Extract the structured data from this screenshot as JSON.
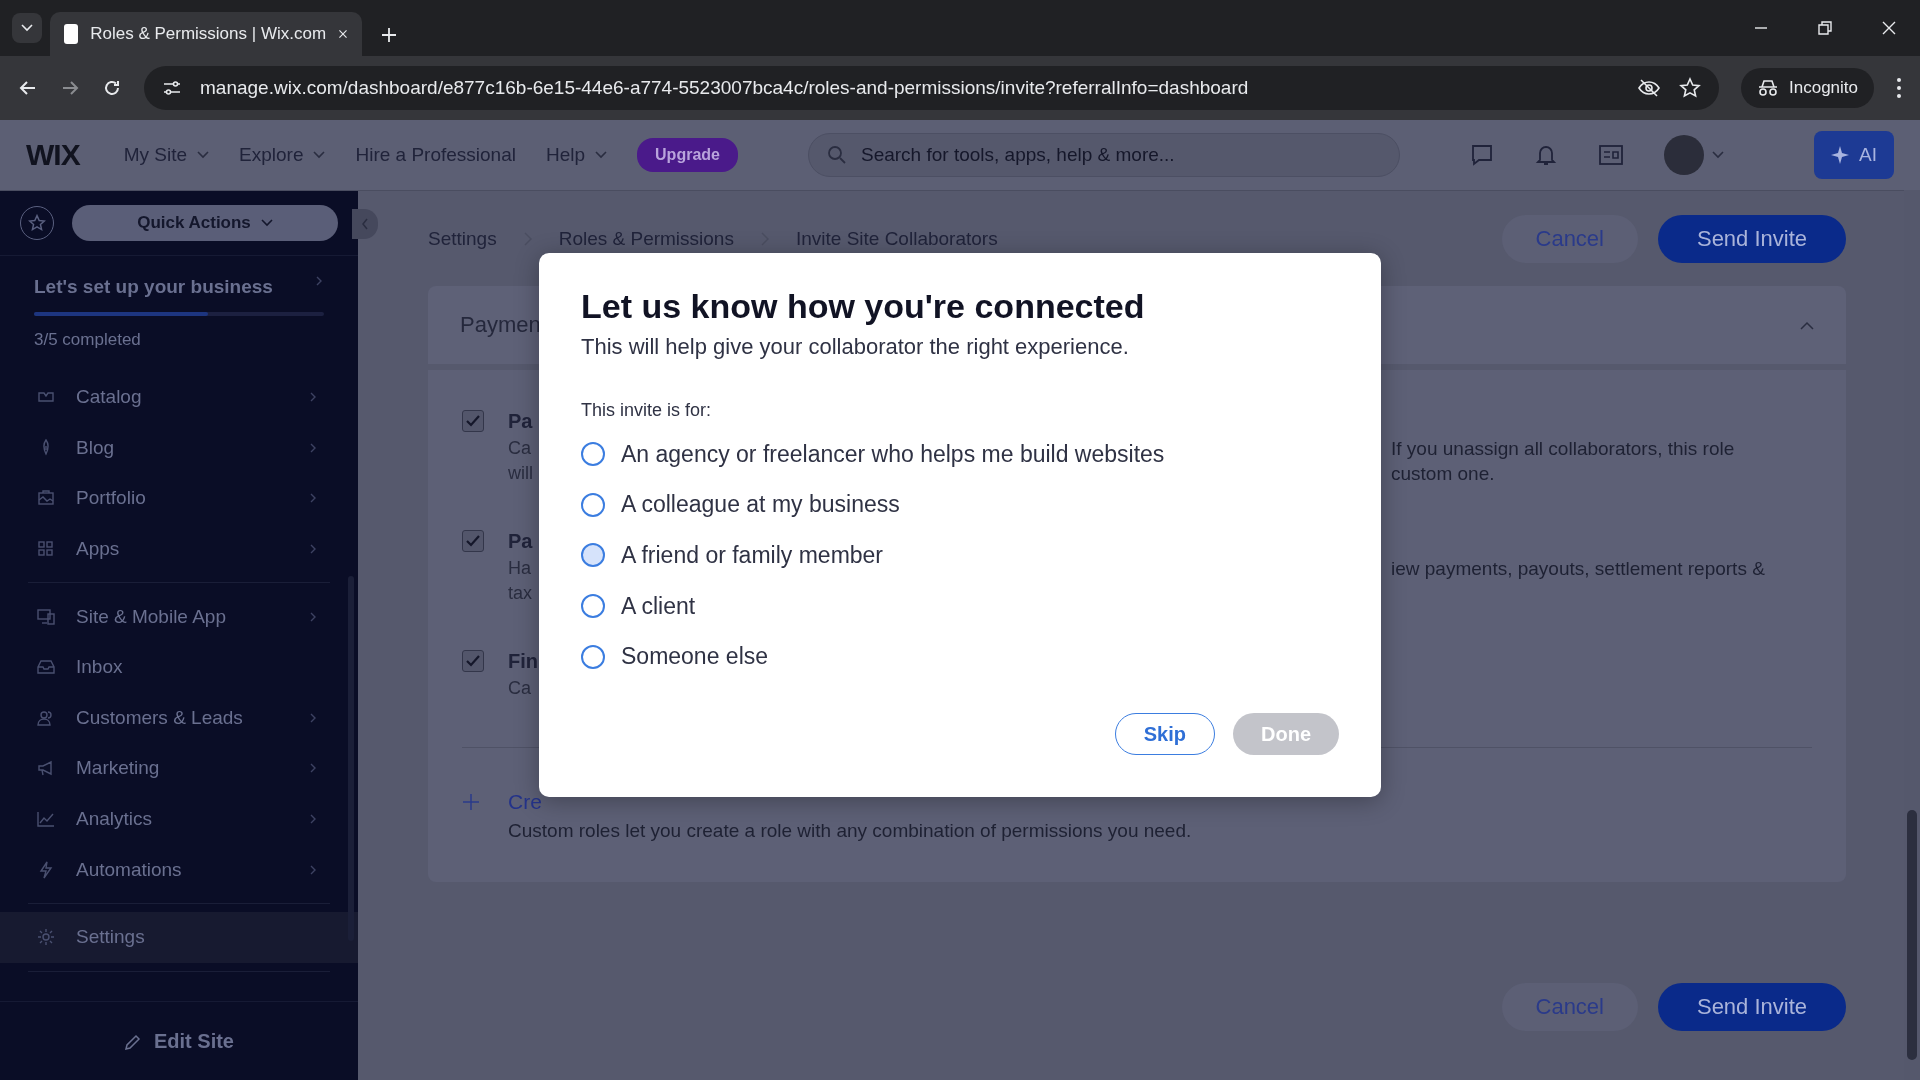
{
  "browser": {
    "tab": {
      "title": "Roles & Permissions | Wix.com"
    },
    "url": "manage.wix.com/dashboard/e877c16b-6e15-44e6-a774-5523007bca4c/roles-and-permissions/invite?referralInfo=dashboard",
    "profile": "Incognito"
  },
  "topbar": {
    "logo": "WIX",
    "nav": [
      {
        "label": "My Site",
        "dropdown": true
      },
      {
        "label": "Explore",
        "dropdown": true
      },
      {
        "label": "Hire a Professional",
        "dropdown": false
      },
      {
        "label": "Help",
        "dropdown": true
      }
    ],
    "upgrade": "Upgrade",
    "search": {
      "placeholder": "Search for tools, apps, help & more..."
    },
    "ai_button": "AI"
  },
  "sidebar": {
    "quick_actions": "Quick Actions",
    "setup": {
      "title": "Let's set up your business",
      "level": 0.6,
      "progress": "3/5 completed"
    },
    "groups": [
      [
        {
          "label": "Catalog",
          "expandable": true,
          "selected": false
        },
        {
          "label": "Blog",
          "expandable": true,
          "selected": false
        },
        {
          "label": "Portfolio",
          "expandable": true,
          "selected": false
        },
        {
          "label": "Apps",
          "expandable": true,
          "selected": false
        }
      ],
      [
        {
          "label": "Site & Mobile App",
          "expandable": true,
          "selected": false
        },
        {
          "label": "Inbox",
          "expandable": false,
          "selected": false
        },
        {
          "label": "Customers & Leads",
          "expandable": true,
          "selected": false
        },
        {
          "label": "Marketing",
          "expandable": true,
          "selected": false
        },
        {
          "label": "Analytics",
          "expandable": true,
          "selected": false
        },
        {
          "label": "Automations",
          "expandable": true,
          "selected": false
        }
      ],
      [
        {
          "label": "Settings",
          "expandable": false,
          "selected": true
        }
      ]
    ],
    "edit_site": "Edit Site"
  },
  "breadcrumbs": [
    "Settings",
    "Roles & Permissions",
    "Invite Site Collaborators"
  ],
  "header_buttons": [
    "Cancel",
    "Send Invite"
  ],
  "section": {
    "title": "Paymen",
    "permissions": [
      {
        "checked": true,
        "title": "Pa",
        "lines": [
          {
            "left": "Ca",
            "right": "If you unassign all collaborators, this role"
          },
          {
            "left": "will",
            "right": "custom one."
          }
        ]
      },
      {
        "checked": true,
        "title": "Pa",
        "lines": [
          {
            "left": "Ha",
            "right": "iew payments, payouts, settlement reports &"
          },
          {
            "left": "tax"
          }
        ]
      },
      {
        "checked": true,
        "title": "Fin",
        "lines": [
          {
            "left": "Ca"
          }
        ]
      }
    ],
    "create": {
      "link": "Cre",
      "description": "Custom roles let you create a role with any combination of permissions you need."
    }
  },
  "footer_buttons": [
    "Cancel",
    "Send Invite"
  ],
  "dialog": {
    "title": "Let us know how you're connected",
    "subtitle": "This will help give your collaborator the right experience.",
    "prompt": "This invite is for:",
    "options": [
      {
        "label": "An agency or freelancer who helps me build websites",
        "selected": false,
        "hovered": false
      },
      {
        "label": "A colleague at my business",
        "selected": false,
        "hovered": false
      },
      {
        "label": "A friend or family member",
        "selected": false,
        "hovered": true
      },
      {
        "label": "A client",
        "selected": false,
        "hovered": false
      },
      {
        "label": "Someone else",
        "selected": false,
        "hovered": false
      }
    ],
    "buttons": [
      {
        "label": "Skip",
        "kind": "secondary",
        "disabled": false
      },
      {
        "label": "Done",
        "kind": "primary",
        "disabled": true
      }
    ]
  }
}
